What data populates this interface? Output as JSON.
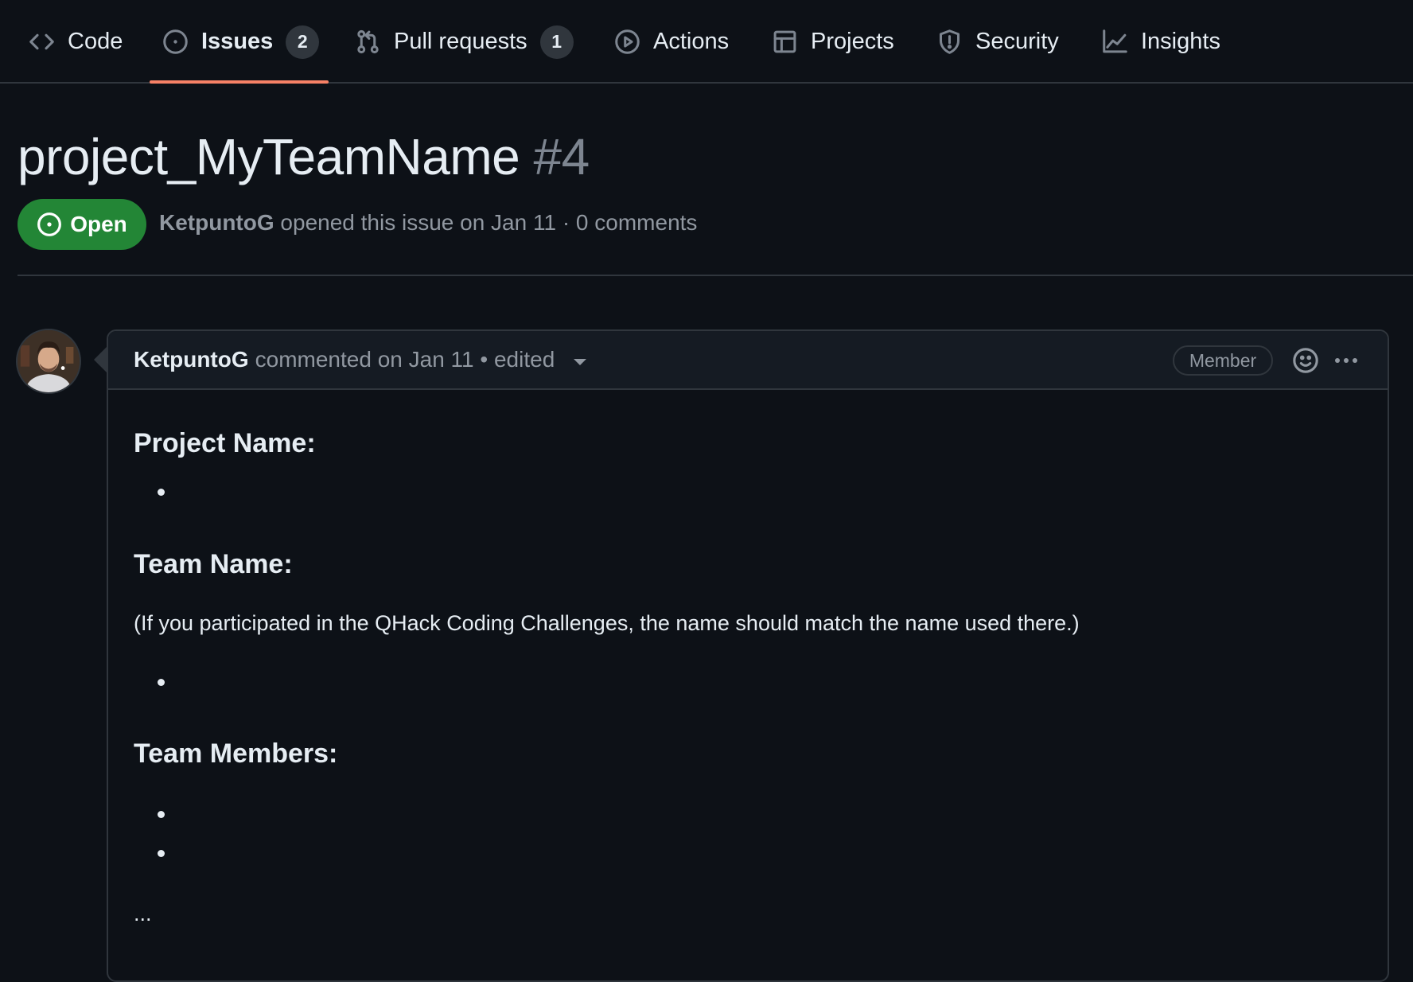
{
  "tabs": [
    {
      "label": "Code",
      "icon": "code-icon",
      "selected": false
    },
    {
      "label": "Issues",
      "icon": "issue-opened-icon",
      "counter": "2",
      "selected": true
    },
    {
      "label": "Pull requests",
      "icon": "git-pull-request-icon",
      "counter": "1",
      "selected": false
    },
    {
      "label": "Actions",
      "icon": "play-icon",
      "selected": false
    },
    {
      "label": "Projects",
      "icon": "table-icon",
      "selected": false
    },
    {
      "label": "Security",
      "icon": "shield-icon",
      "selected": false
    },
    {
      "label": "Insights",
      "icon": "graph-icon",
      "selected": false
    }
  ],
  "issue": {
    "title": "project_MyTeamName",
    "number": "#4",
    "state": "Open",
    "state_color": "#238636",
    "author": "KetpuntoG",
    "opened_text": "opened this issue on Jan 11 · 0 comments"
  },
  "comment": {
    "author": "KetpuntoG",
    "meta_text": "commented on Jan 11 • edited",
    "role_badge": "Member",
    "emoji_icon": "smiley-icon",
    "menu_icon": "kebab-horizontal-icon",
    "body": {
      "heading_project": "Project Name:",
      "heading_team": "Team Name:",
      "team_note": "(If you participated in the QHack Coding Challenges, the name should match the name used there.)",
      "heading_members": "Team Members:",
      "ellipsis": "..."
    }
  },
  "colors": {
    "background": "#0d1117",
    "tab_underline": "#f78166",
    "border": "#30363d"
  }
}
